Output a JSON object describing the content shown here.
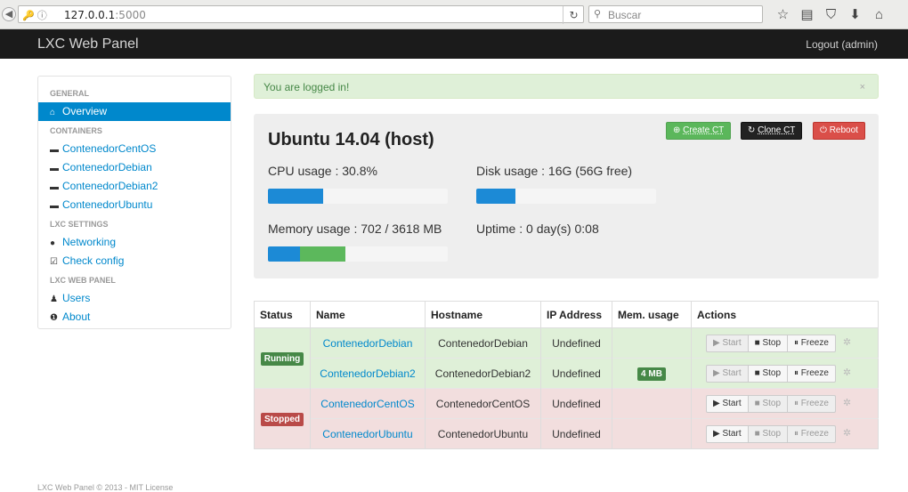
{
  "browser": {
    "url_host": "127.0.0.1",
    "url_port": ":5000",
    "search_placeholder": "Buscar"
  },
  "navbar": {
    "brand": "LXC Web Panel",
    "logout": "Logout (admin)"
  },
  "sidebar": {
    "sections": [
      {
        "header": "GENERAL",
        "items": [
          {
            "label": "Overview",
            "icon": "home-icon",
            "active": true
          }
        ]
      },
      {
        "header": "CONTAINERS",
        "items": [
          {
            "label": "ContenedorCentOS",
            "icon": "server-icon"
          },
          {
            "label": "ContenedorDebian",
            "icon": "server-icon"
          },
          {
            "label": "ContenedorDebian2",
            "icon": "server-icon"
          },
          {
            "label": "ContenedorUbuntu",
            "icon": "server-icon"
          }
        ]
      },
      {
        "header": "LXC SETTINGS",
        "items": [
          {
            "label": "Networking",
            "icon": "globe-icon"
          },
          {
            "label": "Check config",
            "icon": "check-icon"
          }
        ]
      },
      {
        "header": "LXC WEB PANEL",
        "items": [
          {
            "label": "Users",
            "icon": "user-icon"
          },
          {
            "label": "About",
            "icon": "info-icon"
          }
        ]
      }
    ]
  },
  "alert": {
    "message": "You are logged in!",
    "close": "×"
  },
  "host": {
    "title": "Ubuntu 14.04 (host)",
    "create_btn": "Create CT",
    "clone_btn": "Clone CT",
    "reboot_btn": "Reboot",
    "cpu_label": "CPU usage : 30.8%",
    "cpu_percent": 30.8,
    "disk_label": "Disk usage : 16G (56G free)",
    "disk_percent": 22,
    "memory_label": "Memory usage : 702 / 3618 MB",
    "memory_used_percent": 18,
    "memory_cached_percent": 25,
    "uptime_label": "Uptime : 0 day(s) 0:08"
  },
  "table": {
    "headers": [
      "Status",
      "Name",
      "Hostname",
      "IP Address",
      "Mem. usage",
      "Actions"
    ],
    "groups": [
      {
        "status": "Running",
        "rows": [
          {
            "name": "ContenedorDebian",
            "hostname": "ContenedorDebian",
            "ip": "Undefined",
            "mem": ""
          },
          {
            "name": "ContenedorDebian2",
            "hostname": "ContenedorDebian2",
            "ip": "Undefined",
            "mem": "4 MB"
          }
        ]
      },
      {
        "status": "Stopped",
        "rows": [
          {
            "name": "ContenedorCentOS",
            "hostname": "ContenedorCentOS",
            "ip": "Undefined",
            "mem": ""
          },
          {
            "name": "ContenedorUbuntu",
            "hostname": "ContenedorUbuntu",
            "ip": "Undefined",
            "mem": ""
          }
        ]
      }
    ],
    "action_labels": {
      "start": "Start",
      "stop": "Stop",
      "freeze": "Freeze"
    }
  },
  "footer": "LXC Web Panel © 2013 - MIT License"
}
